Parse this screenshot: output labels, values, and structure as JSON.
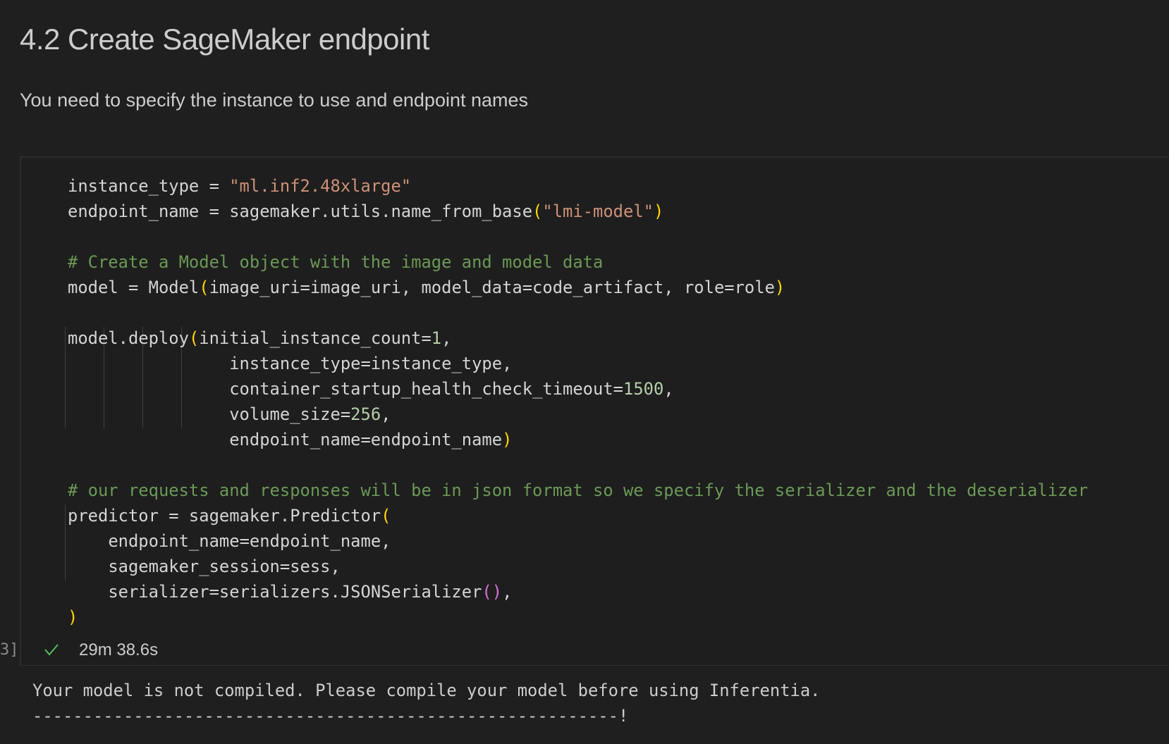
{
  "markdown": {
    "heading": "4.2 Create SageMaker endpoint",
    "description": "You need to specify the instance to use and endpoint names"
  },
  "cell": {
    "code": {
      "l1a": "instance_type = ",
      "l1s": "\"ml.inf2.48xlarge\"",
      "l2a": "endpoint_name = sagemaker.utils.name_from_base",
      "l2p1": "(",
      "l2s": "\"lmi-model\"",
      "l2p2": ")",
      "l4c": "# Create a Model object with the image and model data",
      "l5a": "model = Model",
      "l5p1": "(",
      "l5b": "image_uri=image_uri, model_data=code_artifact, role=role",
      "l5p2": ")",
      "l7a": "model.deploy",
      "l7p1": "(",
      "l7b": "initial_instance_count=",
      "l7n": "1",
      "l7c": ",",
      "l8": "instance_type=instance_type,",
      "l9a": "container_startup_health_check_timeout=",
      "l9n": "1500",
      "l9c": ",",
      "l10a": "volume_size=",
      "l10n": "256",
      "l10c": ",",
      "l11a": "endpoint_name=endpoint_name",
      "l11p": ")",
      "l13c": "# our requests and responses will be in json format so we specify the serializer and the deserializer",
      "l14a": "predictor = sagemaker.Predictor",
      "l14p": "(",
      "l15": "endpoint_name=endpoint_name,",
      "l16": "sagemaker_session=sess,",
      "l17a": "serializer=serializers.JSONSerializer",
      "l17p": "()",
      "l17c": ",",
      "l18p": ")"
    },
    "execution_index": "3]",
    "status_icon": "check-icon",
    "duration": "29m 38.6s",
    "output": {
      "line1": "Your model is not compiled. Please compile your model before using Inferentia.",
      "line2": "----------------------------------------------------------!"
    }
  },
  "colors": {
    "background": "#1f1f1f",
    "string": "#ce9178",
    "number": "#b5cea8",
    "comment": "#6a9955",
    "bracket_level1": "#ffd700",
    "bracket_level2": "#da70d6",
    "success": "#4ec05a"
  }
}
